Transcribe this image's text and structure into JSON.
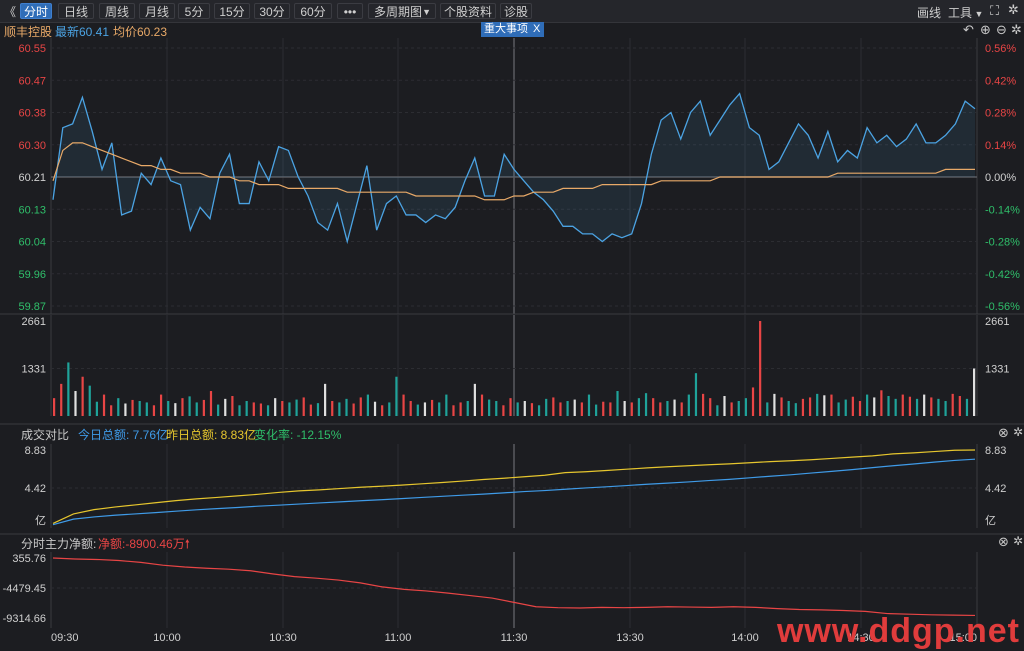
{
  "toolbar": {
    "back_glyph": "《",
    "tabs": [
      {
        "label": "分时",
        "active": true
      },
      {
        "label": "日线"
      },
      {
        "label": "周线"
      },
      {
        "label": "月线"
      },
      {
        "label": "5分"
      },
      {
        "label": "15分"
      },
      {
        "label": "30分"
      },
      {
        "label": "60分"
      }
    ],
    "more_label": "•••",
    "multi_period_label": "多周期图",
    "stock_info_label": "个股资料",
    "diagnose_label": "诊股",
    "draw_label": "画线",
    "tools_label": "工具"
  },
  "info": {
    "stock_name": "顺丰控股",
    "latest_label": "最新60.41",
    "avg_label": "均价60.23",
    "event_button": "重大事项",
    "event_close": "X"
  },
  "colors": {
    "price_line": "#4ba3e3",
    "avg_line": "#e8a968",
    "up": "#e84545",
    "down": "#1fa39a",
    "today_total": "#3f9be8",
    "yesterday_total": "#e6c62e",
    "net_flow": "#e84545"
  },
  "price_axis": {
    "left": [
      "60.55",
      "60.47",
      "60.38",
      "60.30",
      "60.21",
      "60.13",
      "60.04",
      "59.96",
      "59.87"
    ],
    "right": [
      "0.56%",
      "0.42%",
      "0.28%",
      "0.14%",
      "0.00%",
      "-0.14%",
      "-0.28%",
      "-0.42%",
      "-0.56%"
    ]
  },
  "volume_axis": {
    "labels": [
      "2661",
      "1331"
    ]
  },
  "compare_panel": {
    "title": "成交对比",
    "today_label": "今日总额: 7.76亿",
    "yesterday_label": "昨日总额: 8.83亿",
    "change_label": "变化率: -12.15%",
    "axis": [
      "8.83",
      "4.42",
      "亿"
    ]
  },
  "flow_panel": {
    "title": "分时主力净额:",
    "net_label": "净额:-8900.46万",
    "axis": [
      "355.76",
      "-4479.45",
      "-9314.66"
    ]
  },
  "time_axis": [
    "09:30",
    "10:00",
    "10:30",
    "11:00",
    "11:30",
    "13:30",
    "14:00",
    "14:30",
    "15:00"
  ],
  "watermark": "www.ddgp.net",
  "chart_data": [
    {
      "type": "line",
      "title": "",
      "series": [
        {
          "name": "最新",
          "values": [
            60.15,
            60.34,
            60.35,
            60.42,
            60.33,
            60.23,
            60.3,
            60.11,
            60.12,
            60.22,
            60.19,
            60.26,
            60.2,
            60.19,
            60.07,
            60.13,
            60.1,
            60.22,
            60.27,
            60.14,
            60.14,
            60.25,
            60.2,
            60.29,
            60.28,
            60.21,
            60.16,
            60.09,
            60.07,
            60.14,
            60.04,
            60.14,
            60.24,
            60.07,
            60.14,
            60.16,
            60.11,
            60.11,
            60.09,
            60.11,
            60.1,
            60.13,
            60.2,
            60.26,
            60.16,
            60.16,
            60.27,
            60.23,
            60.2,
            60.17,
            60.15,
            60.12,
            60.08,
            60.08,
            60.06,
            60.06,
            60.04,
            60.06,
            60.05,
            60.06,
            60.14,
            60.27,
            60.36,
            60.38,
            60.31,
            60.38,
            60.41,
            60.32,
            60.36,
            60.4,
            60.43,
            60.34,
            60.32,
            60.23,
            60.25,
            60.3,
            60.35,
            60.32,
            60.26,
            60.33,
            60.25,
            60.28,
            60.26,
            60.34,
            60.3,
            60.32,
            60.29,
            60.31,
            60.35,
            60.3,
            60.3,
            60.32,
            60.35,
            60.41,
            60.39
          ]
        },
        {
          "name": "均价",
          "values": [
            60.2,
            60.28,
            60.3,
            60.3,
            60.29,
            60.28,
            60.27,
            60.26,
            60.25,
            60.24,
            60.24,
            60.23,
            60.23,
            60.22,
            60.22,
            60.22,
            60.21,
            60.21,
            60.21,
            60.2,
            60.2,
            60.19,
            60.19,
            60.19,
            60.18,
            60.18,
            60.18,
            60.18,
            60.18,
            60.18,
            60.17,
            60.17,
            60.17,
            60.17,
            60.17,
            60.17,
            60.17,
            60.16,
            60.16,
            60.16,
            60.16,
            60.16,
            60.16,
            60.16,
            60.15,
            60.15,
            60.15,
            60.16,
            60.16,
            60.17,
            60.17,
            60.17,
            60.18,
            60.18,
            60.18,
            60.18,
            60.19,
            60.19,
            60.19,
            60.19,
            60.19,
            60.19,
            60.2,
            60.2,
            60.2,
            60.2,
            60.2,
            60.2,
            60.21,
            60.21,
            60.21,
            60.21,
            60.21,
            60.21,
            60.21,
            60.21,
            60.21,
            60.21,
            60.21,
            60.21,
            60.22,
            60.22,
            60.22,
            60.22,
            60.22,
            60.22,
            60.22,
            60.22,
            60.22,
            60.22,
            60.22,
            60.23,
            60.23,
            60.23,
            60.23
          ]
        }
      ],
      "ylim": [
        59.87,
        60.55
      ]
    },
    {
      "type": "bar",
      "title": "",
      "values": [
        500,
        900,
        1500,
        700,
        1100,
        850,
        400,
        600,
        300,
        500,
        350,
        450,
        420,
        380,
        300,
        600,
        420,
        360,
        500,
        550,
        380,
        450,
        700,
        320,
        480,
        560,
        300,
        420,
        380,
        350,
        300,
        500,
        420,
        380,
        460,
        520,
        320,
        360,
        900,
        420,
        380,
        480,
        350,
        520,
        600,
        400,
        300,
        380,
        1100,
        600,
        420,
        320,
        380,
        450,
        380,
        600,
        300,
        380,
        420,
        900,
        600,
        460,
        420,
        300,
        500,
        380,
        420,
        360,
        300,
        480,
        520,
        380,
        420,
        460,
        380,
        600,
        320,
        400,
        380,
        700,
        420,
        380,
        500,
        640,
        500,
        380,
        420,
        460,
        380,
        600,
        1200,
        620,
        500,
        300,
        560,
        380,
        420,
        500,
        800,
        2661,
        380,
        620,
        520,
        420,
        360,
        480,
        520,
        620,
        580,
        600,
        380,
        460,
        540,
        420,
        600,
        520,
        720,
        560,
        480,
        600,
        540,
        480,
        600,
        520,
        480,
        420,
        620,
        560,
        480,
        1331
      ],
      "ylim": [
        0,
        2661
      ]
    },
    {
      "type": "line",
      "title": "",
      "series": [
        {
          "name": "今日总额",
          "values": [
            0.15,
            0.8,
            1.05,
            1.25,
            1.4,
            1.55,
            1.72,
            1.88,
            2.02,
            2.15,
            2.3,
            2.42,
            2.55,
            2.68,
            2.8,
            2.93,
            3.05,
            3.18,
            3.32,
            3.45,
            3.58,
            3.7,
            3.85,
            4.0,
            4.12,
            4.27,
            4.42,
            4.55,
            4.7,
            4.85,
            4.98,
            5.12,
            5.28,
            5.42,
            5.6,
            5.78,
            5.95,
            6.15,
            6.35,
            6.55,
            6.78,
            7.0,
            7.2,
            7.42,
            7.62,
            7.76
          ]
        },
        {
          "name": "昨日总额",
          "values": [
            0.3,
            1.4,
            1.9,
            2.2,
            2.45,
            2.7,
            2.95,
            3.15,
            3.32,
            3.5,
            3.68,
            3.9,
            4.08,
            4.2,
            4.35,
            4.5,
            4.62,
            4.75,
            4.9,
            5.05,
            5.22,
            5.4,
            5.55,
            5.72,
            5.9,
            6.2,
            6.3,
            6.45,
            6.6,
            6.75,
            6.88,
            7.0,
            7.12,
            7.22,
            7.35,
            7.48,
            7.58,
            7.7,
            7.85,
            8.0,
            8.15,
            8.38,
            8.5,
            8.65,
            8.8,
            8.83
          ]
        }
      ],
      "ylim": [
        0,
        8.83
      ]
    },
    {
      "type": "line",
      "title": "",
      "series": [
        {
          "name": "分时主力净额",
          "values": [
            355.76,
            200,
            120,
            -50,
            -350,
            -800,
            -1100,
            -1300,
            -1450,
            -1700,
            -2200,
            -2650,
            -2900,
            -3200,
            -3650,
            -4300,
            -4700,
            -4950,
            -5300,
            -5700,
            -6100,
            -6800,
            -7500,
            -7650,
            -7700,
            -7600,
            -7650,
            -7600,
            -7500,
            -7550,
            -7600,
            -7500,
            -7600,
            -7800,
            -7950,
            -8000,
            -8100,
            -8250,
            -8600,
            -8700,
            -8800,
            -8850,
            -8900.46
          ]
        }
      ],
      "ylim": [
        -9314.66,
        355.76
      ]
    }
  ]
}
